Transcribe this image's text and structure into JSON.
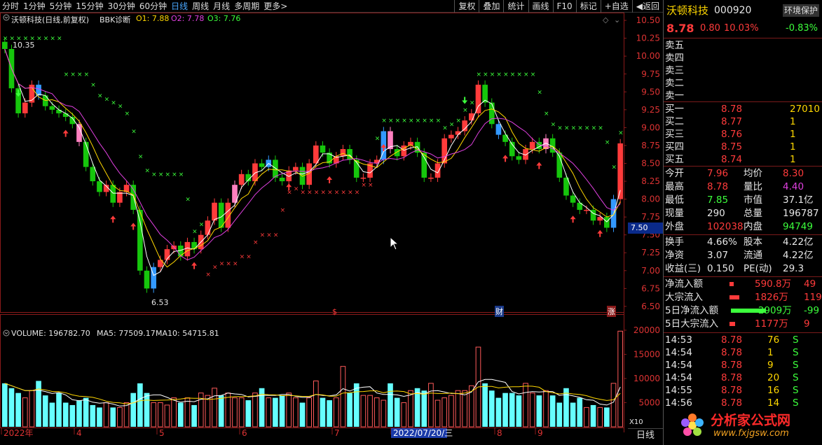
{
  "toolbar": {
    "tabs": [
      "分时",
      "1分钟",
      "5分钟",
      "15分钟",
      "30分钟",
      "60分钟",
      "日线",
      "周线",
      "月线",
      "多周期",
      "更多>"
    ],
    "active_tab": 6,
    "tools": [
      "复权",
      "叠加",
      "统计",
      "画线",
      "F10",
      "标记",
      "+自选",
      "◀返回"
    ]
  },
  "chart_header": {
    "title": "沃顿科技(日线,前复权)",
    "indicator": "BBK诊断",
    "o1": "O1: 7.88",
    "o2": "O2: 7.78",
    "o3": "O3: 7.76",
    "max_label": "10.35",
    "min_label": "6.53",
    "price_tag": "7.50",
    "markers": [
      "$",
      "财",
      "涨"
    ]
  },
  "price_axis": [
    "10.50",
    "10.25",
    "10.00",
    "9.75",
    "9.50",
    "9.25",
    "9.00",
    "8.75",
    "8.50",
    "8.25",
    "8.00",
    "7.75",
    "7.50",
    "7.25",
    "7.00",
    "6.75",
    "6.50"
  ],
  "volume_header": {
    "label": "VOLUME: 196782.70",
    "ma5": "MA5: 77509.17",
    "ma10": "MA10: 54715.81",
    "unit": "X10"
  },
  "volume_axis": [
    "20000",
    "15000",
    "10000",
    "5000"
  ],
  "date_axis": [
    "2022年",
    "4",
    "5",
    "6",
    "7",
    "2022/07/20/三",
    "8",
    "9"
  ],
  "period_label": "日线",
  "colors": {
    "up": "#ff3b3b",
    "down": "#16c60c",
    "blue": "#3399ff",
    "pink": "#ff80c0",
    "yellow": "#ffd700",
    "volume_up": "#ff5a5a",
    "volume_down": "#6ff"
  },
  "quote": {
    "name": "沃顿科技",
    "code": "000920",
    "tag": "环境保护",
    "price": "8.78",
    "change": "0.80",
    "pct": "10.03%",
    "side_pct": "-0.83%",
    "sell": [
      {
        "label": "卖五",
        "price": "",
        "vol": ""
      },
      {
        "label": "卖四",
        "price": "",
        "vol": ""
      },
      {
        "label": "卖三",
        "price": "",
        "vol": ""
      },
      {
        "label": "卖二",
        "price": "",
        "vol": ""
      },
      {
        "label": "卖一",
        "price": "",
        "vol": ""
      }
    ],
    "buy": [
      {
        "label": "买一",
        "price": "8.78",
        "vol": "27010"
      },
      {
        "label": "买二",
        "price": "8.77",
        "vol": "1"
      },
      {
        "label": "买三",
        "price": "8.76",
        "vol": "1"
      },
      {
        "label": "买四",
        "price": "8.75",
        "vol": "1"
      },
      {
        "label": "买五",
        "price": "8.74",
        "vol": "1"
      }
    ],
    "stats": [
      {
        "l1": "今开",
        "v1": "7.96",
        "l2": "均价",
        "v2": "8.30"
      },
      {
        "l1": "最高",
        "v1": "8.78",
        "l2": "量比",
        "v2": "4.40"
      },
      {
        "l1": "最低",
        "v1": "7.85",
        "l2": "市值",
        "v2": "37.1亿"
      },
      {
        "l1": "现量",
        "v1": "290",
        "l2": "总量",
        "v2": "196787"
      },
      {
        "l1": "外盘",
        "v1": "102038",
        "l2": "内盘",
        "v2": "94749"
      }
    ],
    "stats2": [
      {
        "l1": "换手",
        "v1": "4.66%",
        "l2": "股本",
        "v2": "4.22亿"
      },
      {
        "l1": "净资",
        "v1": "3.07",
        "l2": "流通",
        "v2": "4.22亿"
      },
      {
        "l1": "收益(三)",
        "v1": "0.150",
        "l2": "PE(动)",
        "v2": "29.3"
      }
    ],
    "flows": [
      {
        "label": "净流入额",
        "value": "590.8万",
        "extra": "49"
      },
      {
        "label": "大宗流入",
        "value": "1826万",
        "extra": "119"
      },
      {
        "label": "5日净流入额",
        "value": "-2909万",
        "extra": "-99"
      },
      {
        "label": "5日大宗流入",
        "value": "1177万",
        "extra": "9"
      }
    ],
    "ticks": [
      {
        "time": "14:53",
        "price": "8.78",
        "vol": "76",
        "bs": "S"
      },
      {
        "time": "14:54",
        "price": "8.78",
        "vol": "1",
        "bs": "S"
      },
      {
        "time": "14:54",
        "price": "8.78",
        "vol": "9",
        "bs": "S"
      },
      {
        "time": "14:54",
        "price": "8.78",
        "vol": "20",
        "bs": "S"
      },
      {
        "time": "14:55",
        "price": "8.78",
        "vol": "16",
        "bs": "S"
      },
      {
        "time": "14:56",
        "price": "8.78",
        "vol": "14",
        "bs": "S"
      }
    ]
  },
  "watermark": {
    "text": "分析家公式网",
    "url": "www.fxjgsw.com"
  },
  "chart_data": {
    "type": "candlestick",
    "title": "沃顿科技(日线,前复权)",
    "ylim": [
      6.45,
      10.55
    ],
    "close": [
      10.1,
      9.55,
      9.2,
      9.35,
      9.6,
      9.45,
      9.3,
      9.25,
      9.2,
      9.15,
      9.05,
      8.8,
      8.45,
      8.25,
      8.1,
      8.2,
      7.95,
      8.1,
      8.2,
      7.85,
      7.0,
      6.75,
      7.05,
      7.15,
      7.3,
      7.35,
      7.2,
      7.4,
      7.3,
      7.5,
      7.7,
      7.95,
      7.6,
      7.95,
      8.2,
      8.35,
      8.25,
      8.5,
      8.45,
      8.55,
      8.3,
      8.25,
      8.4,
      8.45,
      8.2,
      8.5,
      8.75,
      8.65,
      8.5,
      8.6,
      8.7,
      8.55,
      8.3,
      8.3,
      8.5,
      8.55,
      8.95,
      8.7,
      8.6,
      8.75,
      8.8,
      8.65,
      8.3,
      8.3,
      8.5,
      8.85,
      8.9,
      8.95,
      9.1,
      9.2,
      9.6,
      9.35,
      9.05,
      8.9,
      8.8,
      8.6,
      8.55,
      8.7,
      8.8,
      8.7,
      8.85,
      8.65,
      8.3,
      8.05,
      7.95,
      7.85,
      7.85,
      7.7,
      7.75,
      7.6,
      8.0,
      8.78
    ],
    "volume": [
      9000,
      8000,
      7000,
      6000,
      7500,
      9500,
      6500,
      5000,
      7000,
      5000,
      4500,
      5500,
      6000,
      4500,
      4000,
      5000,
      4000,
      4000,
      5000,
      7000,
      9000,
      7000,
      5000,
      5000,
      4500,
      6000,
      5000,
      6000,
      4500,
      7000,
      6500,
      8000,
      6500,
      7000,
      6000,
      6000,
      5500,
      7000,
      8000,
      6000,
      6000,
      6500,
      7000,
      6000,
      5000,
      6000,
      9500,
      6000,
      5500,
      6000,
      12500,
      7000,
      9000,
      6500,
      6500,
      6000,
      5500,
      9000,
      6000,
      5000,
      7500,
      8000,
      7500,
      9000,
      5500,
      6000,
      6500,
      7500,
      7500,
      8500,
      16500,
      9000,
      7500,
      6000,
      7000,
      7000,
      6500,
      9000,
      7000,
      6500,
      7500,
      6500,
      5000,
      8000,
      5000,
      6000,
      4000,
      4500,
      4000,
      4000,
      9000,
      19800
    ]
  }
}
